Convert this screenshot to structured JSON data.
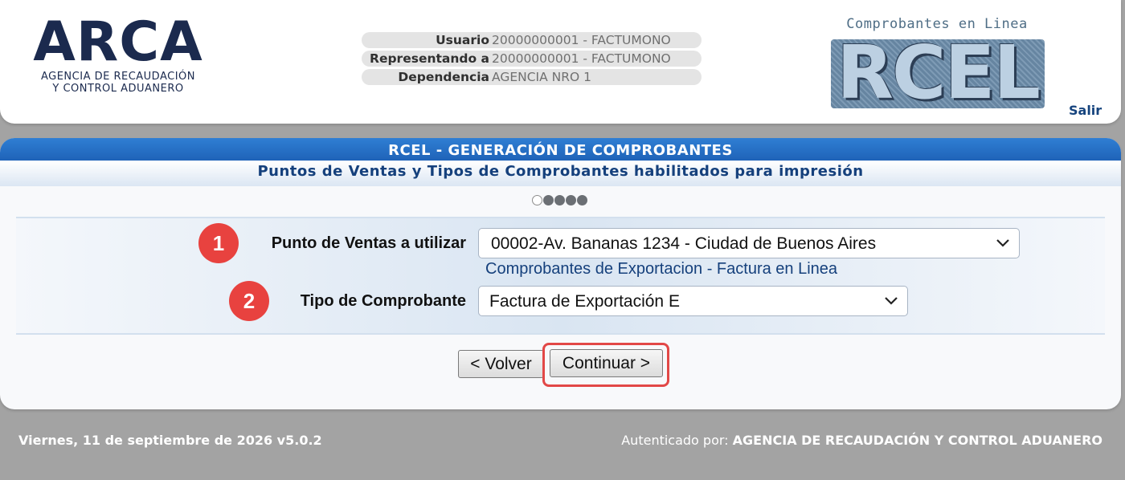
{
  "header": {
    "arca_logo": {
      "word": "ARCA",
      "line1": "AGENCIA DE RECAUDACIÓN",
      "line2": "Y CONTROL ADUANERO"
    },
    "user_info": [
      {
        "label": "Usuario",
        "value": "20000000001 - FACTUMONO"
      },
      {
        "label": "Representando a",
        "value": "20000000001 - FACTUMONO"
      },
      {
        "label": "Dependencia",
        "value": "AGENCIA NRO 1"
      }
    ],
    "rcel_logo": {
      "tagline": "Comprobantes en Linea",
      "word": "RCEL"
    },
    "logout_label": "Salir"
  },
  "panel": {
    "title": "RCEL - GENERACIÓN DE COMPROBANTES",
    "subtitle": "Puntos de Ventas y Tipos de Comprobantes habilitados para impresión",
    "steps": {
      "total": 5,
      "current": 1
    },
    "fields": [
      {
        "badge": "1",
        "label": "Punto de Ventas a utilizar",
        "selected": "00002-Av. Bananas 1234 - Ciudad de Buenos Aires",
        "helper": "Comprobantes de Exportacion - Factura en Linea"
      },
      {
        "badge": "2",
        "label": "Tipo de Comprobante",
        "selected": "Factura de Exportación E"
      }
    ],
    "buttons": {
      "back": "< Volver",
      "continue": "Continuar >"
    }
  },
  "footer": {
    "date_version": "Viernes, 11 de septiembre de 2026 v5.0.2",
    "auth_label": "Autenticado por:",
    "auth_value": "AGENCIA DE RECAUDACIÓN Y CONTROL ADUANERO"
  },
  "colors": {
    "background": "#a3a3a3",
    "title_bar": "#1f63b8",
    "link": "#15407c",
    "highlight": "#e24847",
    "badge": "#e8423f"
  },
  "icons": [
    "chevron-down-icon",
    "step-dot-icon"
  ]
}
